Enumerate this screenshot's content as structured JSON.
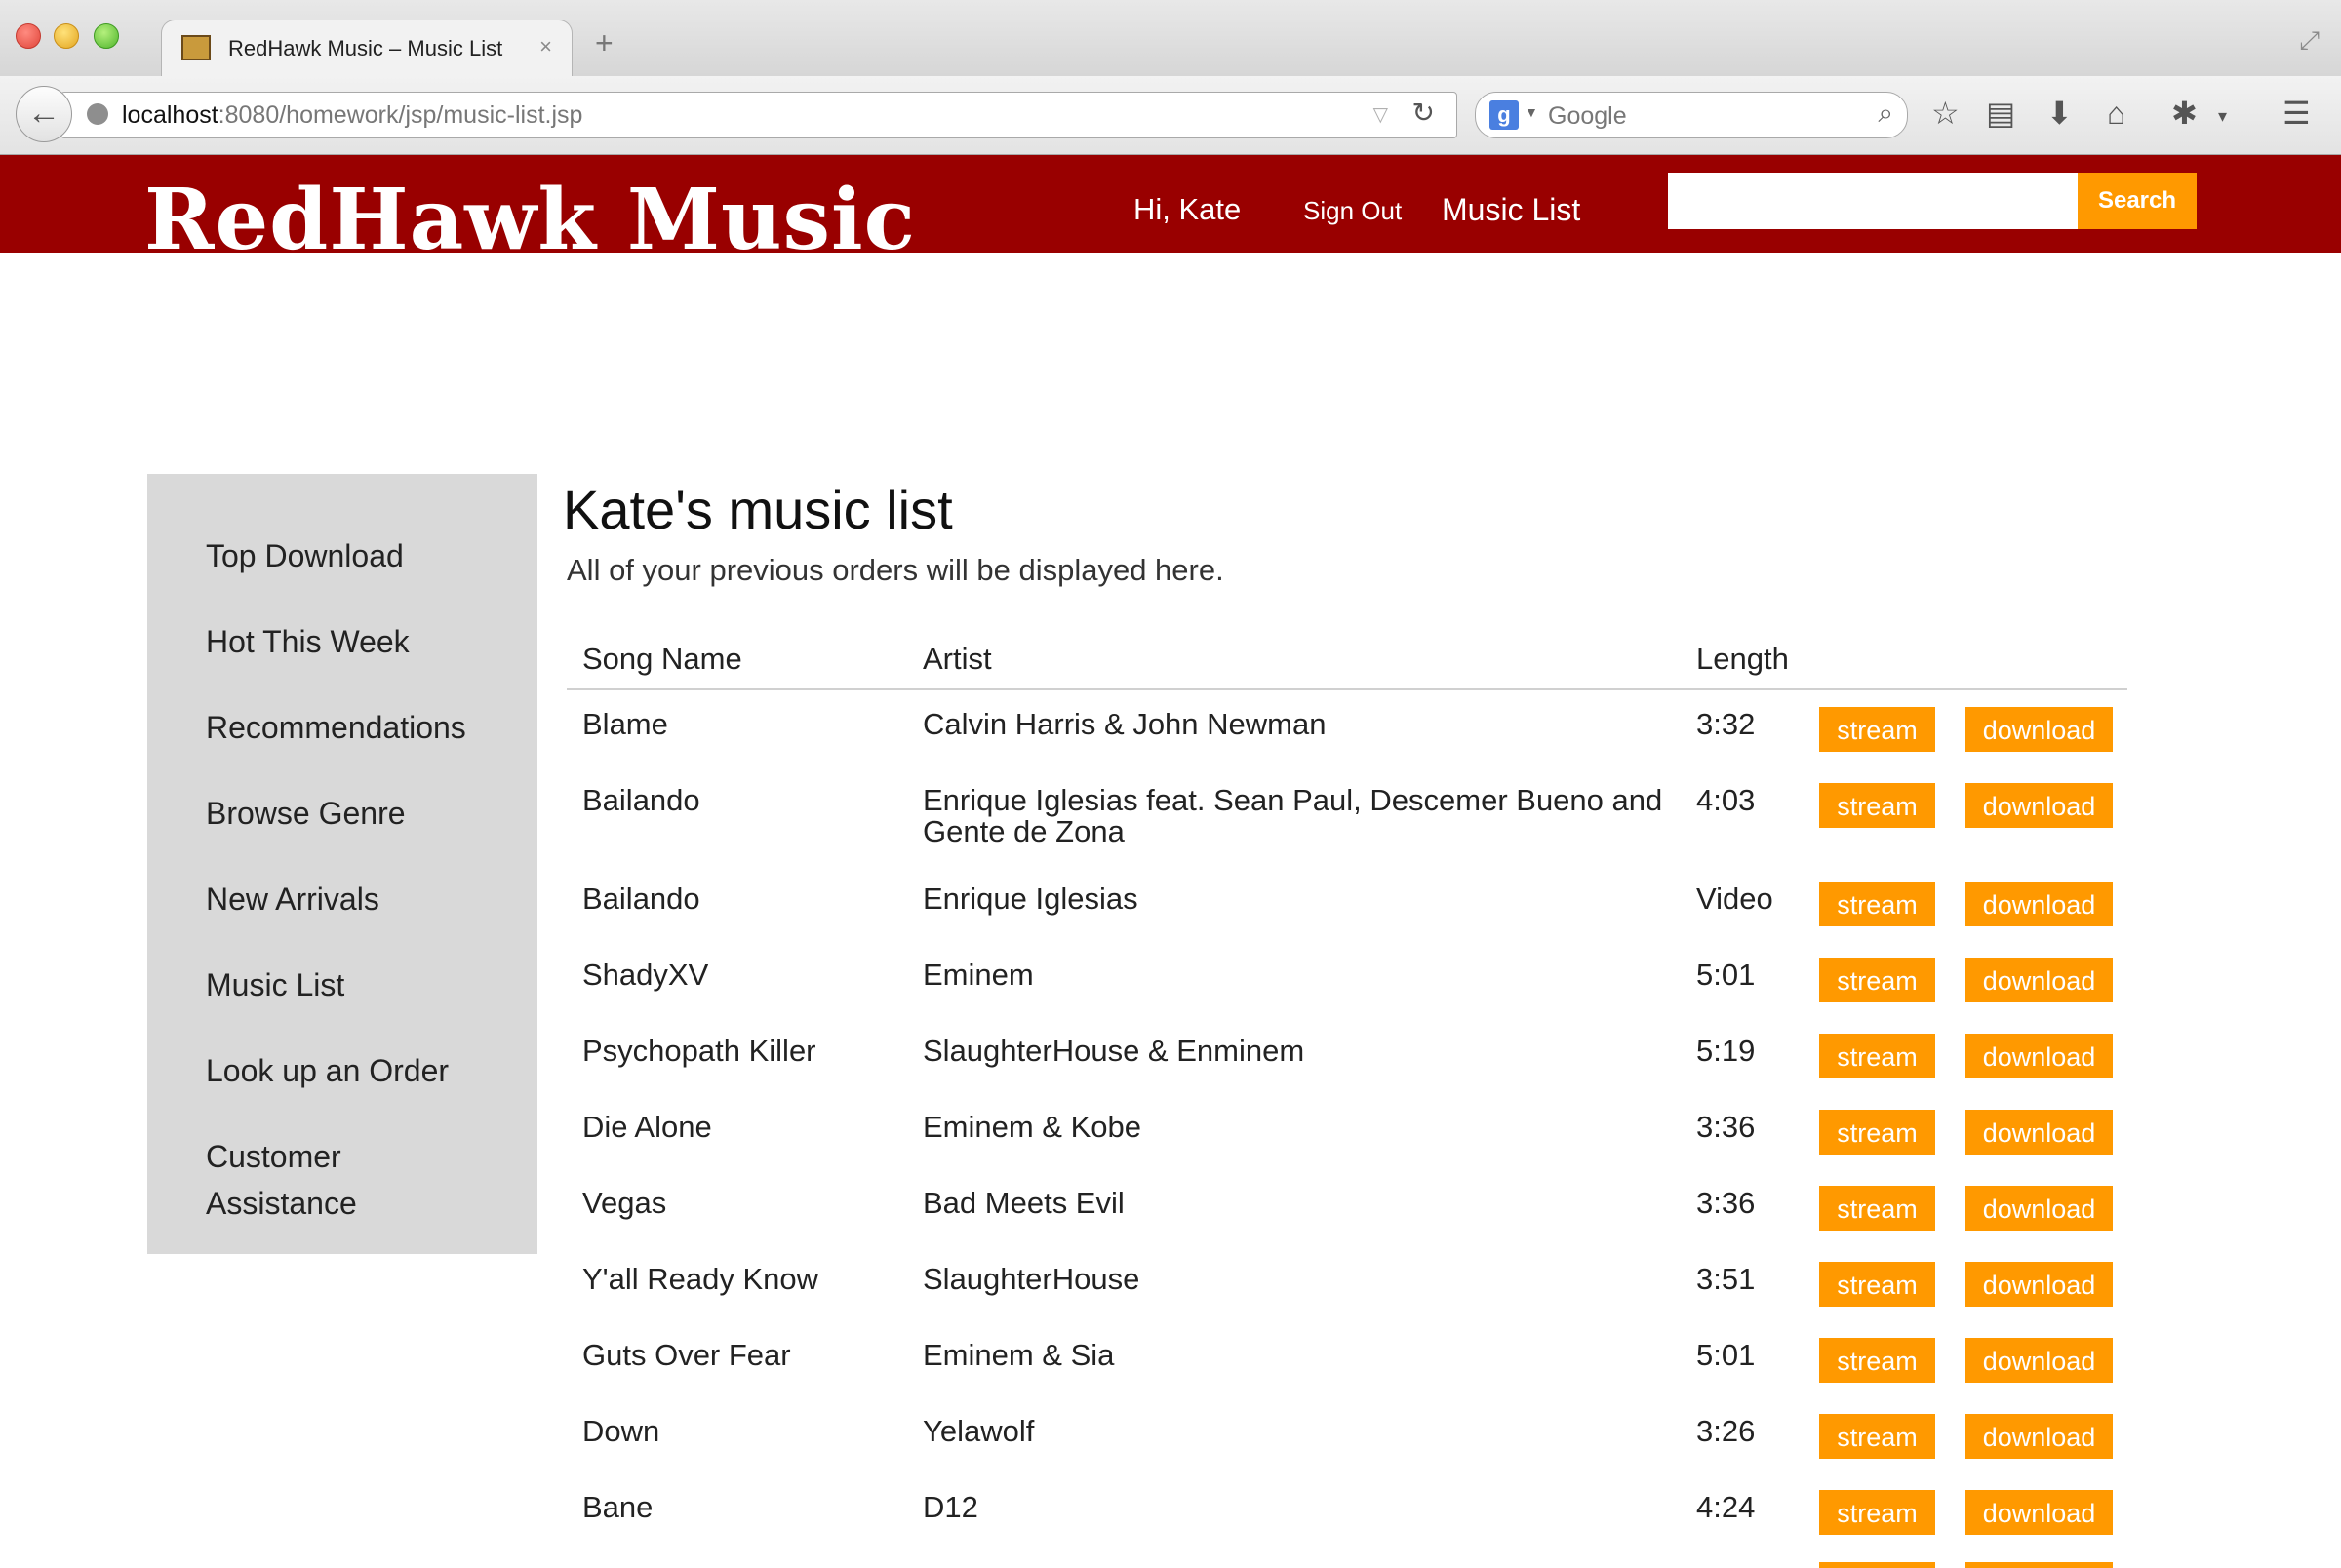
{
  "browser": {
    "tab_title": "RedHawk Music – Music List",
    "tab_close": "×",
    "new_tab": "+",
    "url_host": "localhost",
    "url_path": ":8080/homework/jsp/music-list.jsp",
    "search_placeholder": "Google"
  },
  "header": {
    "logo": "RedHawk Music",
    "greeting": "Hi, Kate",
    "sign_out": "Sign Out",
    "music_list": "Music List",
    "search_button": "Search",
    "search_value": ""
  },
  "sidebar": {
    "items": [
      {
        "label": "Top Download"
      },
      {
        "label": "Hot This Week"
      },
      {
        "label": "Recommendations"
      },
      {
        "label": "Browse Genre"
      },
      {
        "label": "New Arrivals"
      },
      {
        "label": "Music List"
      },
      {
        "label": "Look up an Order"
      },
      {
        "label": "Customer Assistance"
      }
    ]
  },
  "main": {
    "title": "Kate's music list",
    "subtitle": "All of your previous orders will be displayed here.",
    "columns": [
      "Song Name",
      "Artist",
      "Length"
    ],
    "stream_label": "stream",
    "download_label": "download",
    "rows": [
      {
        "song": "Blame",
        "artist": "Calvin Harris & John Newman",
        "length": "3:32"
      },
      {
        "song": "Bailando",
        "artist": "Enrique Iglesias feat. Sean Paul, Descemer Bueno and Gente de Zona",
        "length": "4:03"
      },
      {
        "song": "Bailando",
        "artist": "Enrique Iglesias",
        "length": "Video"
      },
      {
        "song": "ShadyXV",
        "artist": "Eminem",
        "length": "5:01"
      },
      {
        "song": "Psychopath Killer",
        "artist": "SlaughterHouse & Enminem",
        "length": "5:19"
      },
      {
        "song": "Die Alone",
        "artist": "Eminem & Kobe",
        "length": "3:36"
      },
      {
        "song": "Vegas",
        "artist": "Bad Meets Evil",
        "length": "3:36"
      },
      {
        "song": "Y'all Ready Know",
        "artist": "SlaughterHouse",
        "length": "3:51"
      },
      {
        "song": "Guts Over Fear",
        "artist": "Eminem & Sia",
        "length": "5:01"
      },
      {
        "song": "Down",
        "artist": "Yelawolf",
        "length": "3:26"
      },
      {
        "song": "Bane",
        "artist": "D12",
        "length": "4:24"
      }
    ]
  },
  "colors": {
    "header_bg": "#990000",
    "accent": "#ff9900",
    "sidebar_bg": "#d9d9d9"
  }
}
